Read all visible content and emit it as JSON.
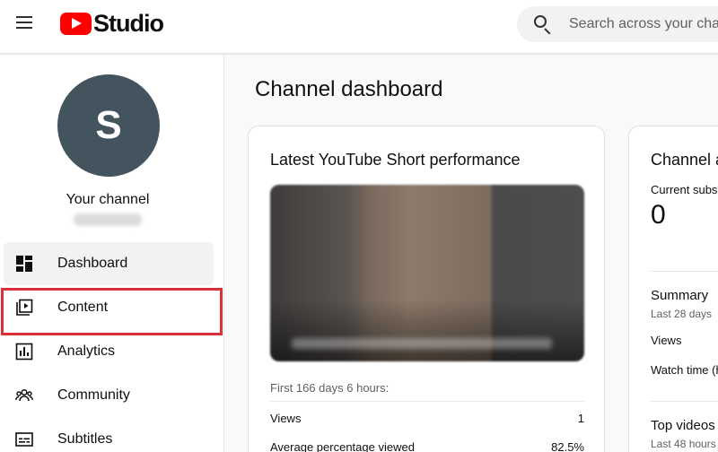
{
  "header": {
    "app_name": "Studio",
    "search_placeholder": "Search across your channel"
  },
  "sidebar": {
    "avatar_letter": "S",
    "channel_title": "Your channel",
    "items": [
      {
        "label": "Dashboard",
        "icon": "dashboard-icon",
        "active": true
      },
      {
        "label": "Content",
        "icon": "content-icon",
        "active": false
      },
      {
        "label": "Analytics",
        "icon": "analytics-icon",
        "active": false
      },
      {
        "label": "Community",
        "icon": "community-icon",
        "active": false
      },
      {
        "label": "Subtitles",
        "icon": "subtitles-icon",
        "active": false
      }
    ],
    "highlighted_item": "Content",
    "highlight_color": "#d9303a"
  },
  "main": {
    "page_title": "Channel dashboard",
    "short_card": {
      "title": "Latest YouTube Short performance",
      "period": "First 166 days 6 hours:",
      "stats": [
        {
          "label": "Views",
          "value": "1"
        },
        {
          "label": "Average percentage viewed",
          "value": "82.5%"
        }
      ]
    },
    "analytics_card": {
      "title": "Channel analytics",
      "current_subscribers_label": "Current subscribers",
      "current_subscribers_value": "0",
      "summary_title": "Summary",
      "summary_period": "Last 28 days",
      "summary_rows": [
        "Views",
        "Watch time (hours)"
      ],
      "top_videos_title": "Top videos",
      "top_videos_period": "Last 48 hours"
    }
  },
  "colors": {
    "brand_red": "#ff0000",
    "avatar_bg": "#43545e",
    "active_nav_bg": "#f2f2f2"
  }
}
